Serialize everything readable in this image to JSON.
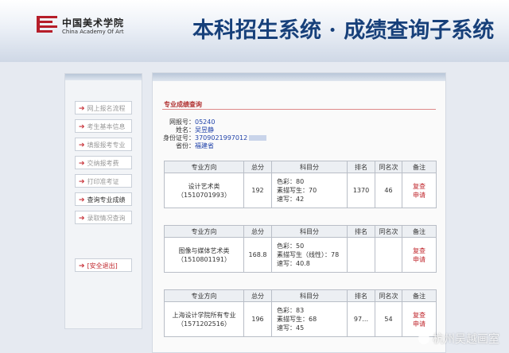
{
  "header": {
    "logo_cn": "中国美术学院",
    "logo_en": "China Academy Of Art",
    "title": "本科招生系统 · 成绩查询子系统"
  },
  "sidebar": {
    "items": [
      {
        "label": "网上报名流程",
        "active": false
      },
      {
        "label": "考生基本信息",
        "active": false
      },
      {
        "label": "填报报考专业",
        "active": false
      },
      {
        "label": "交纳报考费",
        "active": false
      },
      {
        "label": "打印准考证",
        "active": false
      },
      {
        "label": "查询专业成绩",
        "active": true
      },
      {
        "label": "录取情况查询",
        "active": false
      }
    ],
    "logout": "[安全退出]"
  },
  "main": {
    "section_title": "专业成绩查询",
    "info": [
      {
        "label": "网报号：",
        "value": "05240"
      },
      {
        "label": "姓名：",
        "value": "吴昱静"
      },
      {
        "label": "身份证号：",
        "value": "3709021997012"
      },
      {
        "label": "省份：",
        "value": "福建省"
      }
    ],
    "headers": [
      "专业方向",
      "总分",
      "科目分",
      "排名",
      "同名次",
      "备注"
    ],
    "rows": [
      {
        "major": "设计艺术类",
        "code": "（1510701993）",
        "total": "192",
        "subjects": [
          "色彩：80",
          "素描写生：70",
          "速写：42"
        ],
        "rank": "1370",
        "same": "46",
        "note": [
          "复查",
          "申请"
        ]
      },
      {
        "major": "图像与媒体艺术类",
        "code": "（1510801191）",
        "total": "168.8",
        "subjects": [
          "色彩：50",
          "素描写生（线性）：78",
          "速写：40.8"
        ],
        "rank": "",
        "same": "",
        "note": [
          "复查",
          "申请"
        ]
      },
      {
        "major": "上海设计学院所有专业",
        "code": "（1571202516）",
        "total": "196",
        "subjects": [
          "色彩：83",
          "素描写生：68",
          "速写：45"
        ],
        "rank": "97…",
        "same": "54",
        "note": [
          "复查",
          "申请"
        ]
      }
    ]
  },
  "watermark": "杭州吴越画室",
  "colors": {
    "brand_red": "#b61e2a",
    "title_blue": "#17407a",
    "link_blue": "#2244aa",
    "review_red": "#c0282e"
  }
}
